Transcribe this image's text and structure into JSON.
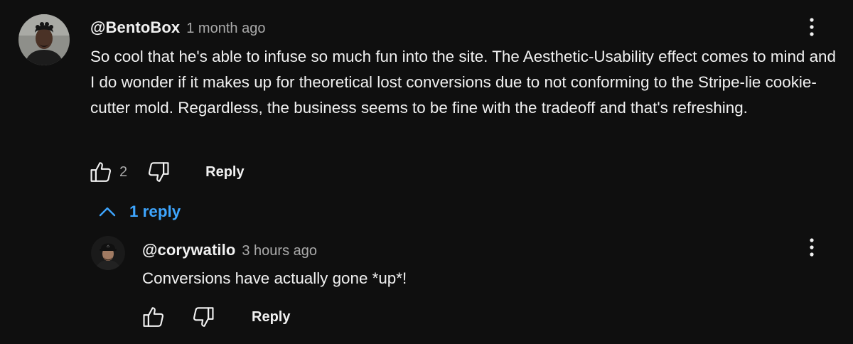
{
  "colors": {
    "background": "#0f0f0f",
    "text_primary": "#f1f1f1",
    "text_secondary": "#aaaaaa",
    "link_blue": "#3ea6ff"
  },
  "comment": {
    "author": "@BentoBox",
    "time": "1 month ago",
    "text": "So cool that he's able to infuse so much fun into the site. The Aesthetic-Usability effect comes to mind and I do wonder if it makes up for theoretical lost conversions due to not conforming to the Stripe-lie cookie-cutter mold. Regardless, the business seems to be fine with the tradeoff and that's refreshing.",
    "like_count": "2",
    "reply_label": "Reply",
    "icons": {
      "menu": "more-vert-icon",
      "like": "thumbs-up-icon",
      "dislike": "thumbs-down-icon"
    }
  },
  "replies_toggle": {
    "label": "1 reply",
    "icon": "chevron-up-icon"
  },
  "reply": {
    "author": "@corywatilo",
    "time": "3 hours ago",
    "text": "Conversions have actually gone *up*!",
    "reply_label": "Reply"
  }
}
